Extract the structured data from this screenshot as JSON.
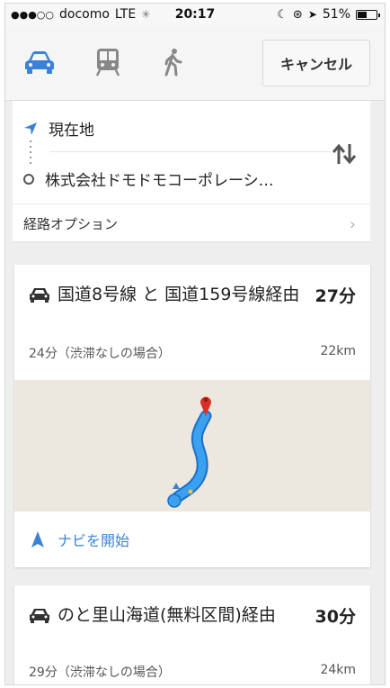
{
  "status_bar": {
    "signal": "●●●○○",
    "carrier": "docomo",
    "network": "LTE",
    "time": "20:17",
    "battery_text": "51%",
    "battery_level": 0.51
  },
  "modes": {
    "selected": "car",
    "cancel_label": "キャンセル"
  },
  "route_input": {
    "from_label": "現在地",
    "to_label": "株式会社ドモドモコーポレーシ…",
    "options_label": "経路オプション"
  },
  "routes": [
    {
      "name": "国道8号線 と 国道159号線経由",
      "duration": "27分",
      "note": "24分（渋滞なしの場合）",
      "distance": "22km",
      "start_nav_label": "ナビを開始"
    },
    {
      "name": "のと里山海道(無料区間)経由",
      "duration": "30分",
      "note": "29分（渋滞なしの場合）",
      "distance": "24km"
    }
  ],
  "colors": {
    "accent": "#3b82d6",
    "route_line": "#2f8fe6",
    "map_bg": "#ede8df",
    "pin": "#d93025"
  }
}
